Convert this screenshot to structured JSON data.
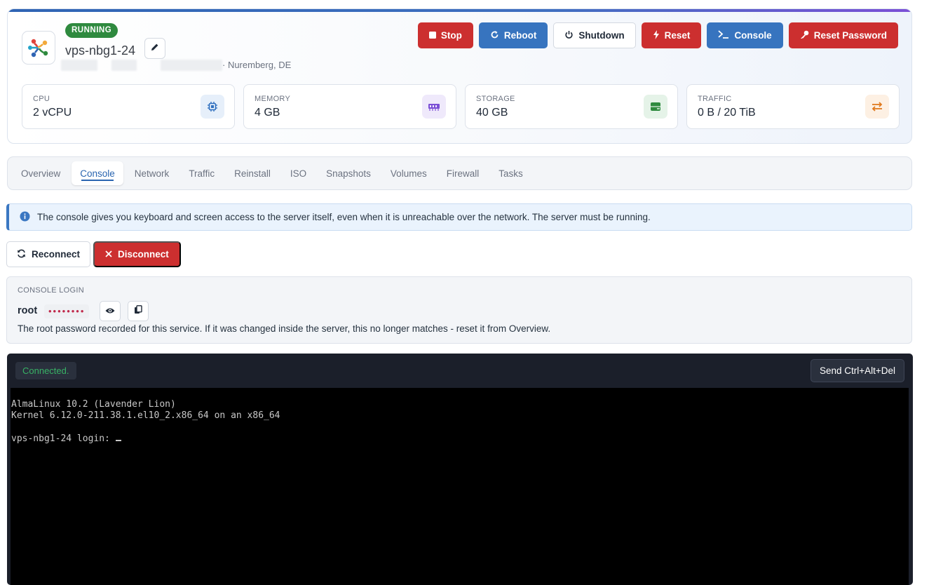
{
  "server": {
    "status": "RUNNING",
    "hostname": "vps-nbg1-24",
    "location": "· Nuremberg, DE"
  },
  "actions": {
    "stop": "Stop",
    "reboot": "Reboot",
    "shutdown": "Shutdown",
    "reset": "Reset",
    "console": "Console",
    "reset_password": "Reset Password"
  },
  "stats": [
    {
      "label": "CPU",
      "value": "2 vCPU",
      "icon": "cpu-chip-icon",
      "color": "#2f6fbf"
    },
    {
      "label": "MEMORY",
      "value": "4 GB",
      "icon": "memory-icon",
      "color": "#7b4fd6"
    },
    {
      "label": "STORAGE",
      "value": "40 GB",
      "icon": "storage-drive-icon",
      "color": "#2f8a3f"
    },
    {
      "label": "TRAFFIC",
      "value": "0 B / 20 TiB",
      "icon": "traffic-arrows-icon",
      "color": "#e07a1f"
    }
  ],
  "tabs": [
    "Overview",
    "Console",
    "Network",
    "Traffic",
    "Reinstall",
    "ISO",
    "Snapshots",
    "Volumes",
    "Firewall",
    "Tasks"
  ],
  "active_tab": "Console",
  "info": {
    "text": "The console gives you keyboard and screen access to the server itself, even when it is unreachable over the network. The server must be running."
  },
  "console_controls": {
    "reconnect": "Reconnect",
    "disconnect": "Disconnect"
  },
  "console_login": {
    "label": "CONSOLE LOGIN",
    "user": "root",
    "password_mask": "••••••••",
    "note": "The root password recorded for this service. If it was changed inside the server, this no longer matches - reset it from Overview."
  },
  "console": {
    "status": "Connected.",
    "send_cad": "Send Ctrl+Alt+Del",
    "lines": [
      "AlmaLinux 10.2 (Lavender Lion)",
      "Kernel 6.12.0-211.38.1.el10_2.x86_64 on an x86_64",
      "",
      "vps-nbg1-24 login: "
    ]
  },
  "colors": {
    "danger": "#cc2f2f",
    "primary": "#3774bf",
    "success": "#2f8a3f",
    "accent": "#2a65b0"
  }
}
